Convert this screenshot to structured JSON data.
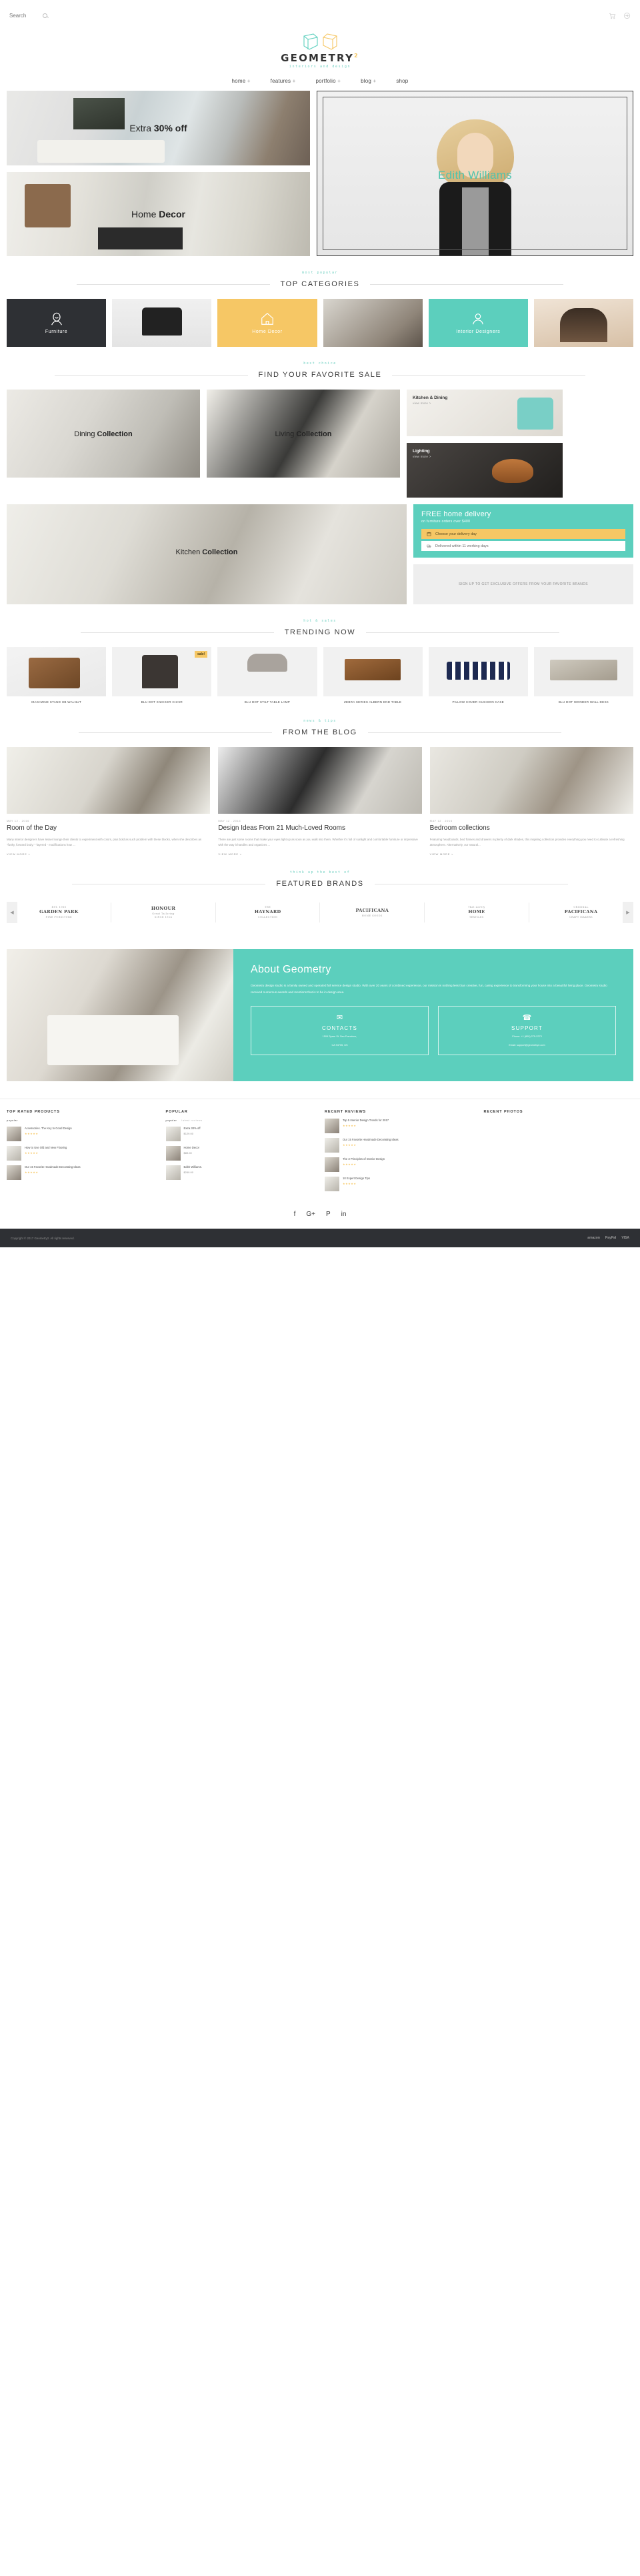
{
  "header": {
    "search_placeholder": "Search",
    "search_value": "",
    "search_icon": "search-icon",
    "cart_icon": "cart-icon",
    "login_icon": "login-icon",
    "logo_text": "GEOMETRY",
    "logo_sup": "2",
    "logo_tagline": "interiors and design",
    "nav": [
      {
        "label": "home",
        "plus": "+"
      },
      {
        "label": "features",
        "plus": "+"
      },
      {
        "label": "portfolio",
        "plus": "+"
      },
      {
        "label": "blog",
        "plus": "+"
      },
      {
        "label": "shop",
        "plus": ""
      }
    ]
  },
  "hero": {
    "tile_extra_pre": "Extra ",
    "tile_extra_bold": "30% off",
    "tile_decor_pre": "Home ",
    "tile_decor_bold": "Decor",
    "model_name": "Edith Williams"
  },
  "top_categories": {
    "kicker": "most popular",
    "title": "TOP CATEGORIES",
    "items": [
      {
        "label": "Furniture",
        "icon": "person-icon",
        "style": "dark"
      },
      {
        "label": "",
        "icon": "",
        "style": "photo-chair"
      },
      {
        "label": "Home Decor",
        "icon": "house-icon",
        "style": "amber"
      },
      {
        "label": "",
        "icon": "",
        "style": "photo-room"
      },
      {
        "label": "Interior Designers",
        "icon": "designer-icon",
        "style": "teal"
      },
      {
        "label": "",
        "icon": "",
        "style": "photo-girl"
      }
    ]
  },
  "favorite_sale": {
    "kicker": "best choice",
    "title": "FIND YOUR FAVORITE SALE",
    "dining_pre": "Dining ",
    "dining_bold": "Collection",
    "living_pre": "Living ",
    "living_bold": "Collection",
    "kitchen_title": "Kitchen & Dining",
    "kitchen_link": "view more >",
    "lighting_title": "Lighting",
    "lighting_link": "view more >",
    "room_pre": "Kitchen ",
    "room_bold": "Collection",
    "promo_free": "FREE",
    "promo_rest": " home delivery",
    "promo_sub": "on furniture orders over $400",
    "promo_line1": "Choose your delivery day",
    "promo_line2": "Delivered within 11 working days",
    "newsletter": "SIGN UP TO GET EXCLUSIVE OFFERS FROM YOUR FAVORITE BRANDS"
  },
  "trending": {
    "kicker": "hot & sales",
    "title": "TRENDING NOW",
    "products": [
      {
        "name": "MAGAZINE STAND HB WALNUT",
        "badge": ""
      },
      {
        "name": "BLU DOT KNICKER CHAIR",
        "badge": "sale!"
      },
      {
        "name": "BLU DOT STILT TABLE LAMP",
        "badge": ""
      },
      {
        "name": "ZEBRA SERIES ALBERN END TABLE",
        "badge": ""
      },
      {
        "name": "PILLOW COVER CUSHION CASE",
        "badge": ""
      },
      {
        "name": "BLU DOT WONDER WALL DESK",
        "badge": ""
      }
    ]
  },
  "blog": {
    "kicker": "news & tips",
    "title": "FROM THE BLOG",
    "posts": [
      {
        "date": "MAY 12 . 2016",
        "title": "Room of the Day",
        "excerpt": "Many interior designers have lesser lounge their clients to experiment with colors, plus bold as such problem with these blocks, when she describes as \"funky, forward body,\" \"layered - modifications how ...",
        "more": "VIEW MORE >"
      },
      {
        "date": "MAY 12 . 2016",
        "title": "Design Ideas From 21 Much-Loved Rooms",
        "excerpt": "There are just some rooms that make your eyes light up as soon as you walk into them. Whether it's full of sunlight and comfortable furniture or impressive with the way it handles and organizes ...",
        "more": "VIEW MORE >"
      },
      {
        "date": "MAY 12 . 2016",
        "title": "Bedroom collections",
        "excerpt": "Featuring headboards, bed frames and drawers in plenty of dark shades, this inspiring collection provides everything you need to cultivate a refreshing atmosphere. Alternatively, our natural...",
        "more": "VIEW MORE >"
      }
    ]
  },
  "brands": {
    "kicker": "think up the best of",
    "title": "FEATURED BRANDS",
    "prev_icon": "chevron-left-icon",
    "next_icon": "chevron-right-icon",
    "items": [
      {
        "top": "EST. 1968",
        "main": "GARDEN PARK",
        "bottom": "FINE FURNITURE"
      },
      {
        "top": "HONOUR",
        "main": "Great Tailoring",
        "bottom": "SINCE 1924"
      },
      {
        "top": "THE",
        "main": "HAYNARD",
        "bottom": "COLLECTION"
      },
      {
        "top": "",
        "main": "PACIFICANA",
        "bottom": "HOME GOODS"
      },
      {
        "top": "That Lovely",
        "main": "HOME",
        "bottom": "TEXTILES"
      },
      {
        "top": "ORIGINAL",
        "main": "PACIFICANA",
        "bottom": "CRAFT MAKERS"
      }
    ]
  },
  "about": {
    "title": "About Geometry",
    "text": "Geometry design studio is a family owned and operated full service design studio. With over 20 years of combined experience, our mission is nothing less than creative, fun, caring experience to transforming your house into a beautiful living place. Geometry studio received numerous awards and mentions that is to be in design area.",
    "contacts": {
      "icon": "envelope-icon",
      "title": "CONTACTS",
      "line1": "1509 Spare St. San Francisco,",
      "line2": "CA 94705, US"
    },
    "support": {
      "icon": "phone-icon",
      "title": "SUPPORT",
      "line1": "Phone: +1 (800) 275-2273",
      "line2": "Email: support@geometry2.com"
    }
  },
  "footer": {
    "columns": [
      {
        "heading": "TOP RATED PRODUCTS",
        "tabs": [
          {
            "label": "popular",
            "active": true
          }
        ],
        "items": [
          {
            "title": "Accessories. The Key to Good Design",
            "stars": "★★★★★",
            "price": "",
            "thumb": "t-a"
          },
          {
            "title": "How to Use Old and New Flooring",
            "stars": "★★★★★",
            "price": "",
            "thumb": "t-b"
          },
          {
            "title": "Our 15 Favorite Handmade Decorating Ideas",
            "stars": "★★★★★",
            "price": "",
            "thumb": "t-a"
          }
        ]
      },
      {
        "heading": "POPULAR",
        "tabs": [
          {
            "label": "popular",
            "active": true
          },
          {
            "label": "latest reviews",
            "active": false
          }
        ],
        "items": [
          {
            "title": "Extra 30% off",
            "stars": "",
            "price": "$129.00",
            "thumb": "t-b"
          },
          {
            "title": "Home Decor",
            "stars": "",
            "price": "$89.00",
            "thumb": "t-a"
          },
          {
            "title": "Edith Williams.",
            "stars": "",
            "price": "$240.00",
            "thumb": "t-b"
          }
        ]
      },
      {
        "heading": "RECENT REVIEWS",
        "tabs": [],
        "items": [
          {
            "title": "Top 5 Interior Design Trends for 2017",
            "stars": "★★★★★",
            "price": "",
            "thumb": "t-a"
          },
          {
            "title": "Our 15 Favorite Handmade Decorating Ideas",
            "stars": "★★★★★",
            "price": "",
            "thumb": "t-b"
          },
          {
            "title": "The 3 Principles of Interior Design",
            "stars": "★★★★★",
            "price": "",
            "thumb": "t-a"
          },
          {
            "title": "10 Expert Design Tips",
            "stars": "★★★★★",
            "price": "",
            "thumb": "t-b"
          }
        ]
      },
      {
        "heading": "RECENT PHOTOS",
        "tabs": [],
        "items": []
      }
    ],
    "social": [
      {
        "icon": "facebook-icon",
        "glyph": "f"
      },
      {
        "icon": "google-plus-icon",
        "glyph": "G+"
      },
      {
        "icon": "pinterest-icon",
        "glyph": "P"
      },
      {
        "icon": "linkedin-icon",
        "glyph": "in"
      }
    ],
    "copyright": "Copyright © 2017 Geometry2. All rights reserved.",
    "payments": [
      "amazon",
      "PayPal",
      "VISA"
    ]
  },
  "colors": {
    "teal": "#5ccfbd",
    "amber": "#f6c765",
    "dark": "#2e3034"
  }
}
